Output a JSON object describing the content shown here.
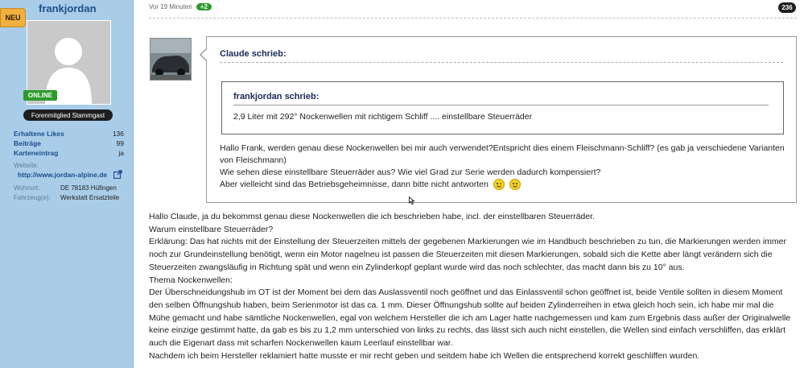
{
  "sidebar": {
    "badge": "NEU",
    "username": "frankjordan",
    "online": "ONLINE",
    "rank": "Forenmitglied Stammgast",
    "stats": [
      {
        "label": "Erhaltene Likes",
        "value": "136"
      },
      {
        "label": "Beiträge",
        "value": "99"
      },
      {
        "label": "Karteneintrag",
        "value": "ja"
      }
    ],
    "website_label": "Website:",
    "website_url": "http://www.jordan-alpine.de",
    "wohnort_label": "Wohnort:",
    "wohnort_value": "DE 78183 Hüfingen",
    "fahrzeug_label": "Fahrzeug(e):",
    "fahrzeug_value": "Werkstatt Ersatzteile"
  },
  "post": {
    "time": "Vor 19 Minuten",
    "plus": "+2",
    "number": "236"
  },
  "quote": {
    "author": "Claude schrieb:",
    "inner_author": "frankjordan schrieb:",
    "inner_text": "2,9 Liter mit 292° Nockenwellen mit richtigem Schliff .... einstellbare Steuerräder",
    "lines": [
      "Hallo Frank, werden genau diese Nockenwellen bei mir auch verwendet?Entspricht dies einem Fleischmann-Schliff? (es gab ja verschiedene Varianten von Fleischmann)",
      "Wie sehen diese einstellbare Steuerräder aus? Wie viel Grad zur Serie werden dadurch kompensiert?",
      "Aber vielleicht sind das Betriebsgeheimnisse, dann bitte nicht antworten"
    ]
  },
  "reply": {
    "lines": [
      "Hallo Claude, ja du bekommst genau diese Nockenwellen die ich beschrieben habe, incl. der einstellbaren Steuerräder.",
      "Warum einstellbare Steuerräder?",
      "Erklärung: Das hat nichts mit der Einstellung der Steuerzeiten mittels der gegebenen Markierungen wie im Handbuch beschrieben zu tun, die Markierungen werden immer noch zur Grundeinstellung benötigt, wenn ein Motor nagelneu ist passen die Steuerzeiten mit diesen Markierungen, sobald sich die Kette aber längt verändern sich die Steuerzeiten zwangsläufig in Richtung spät und wenn ein Zylinderkopf geplant wurde wird das noch schlechter, das macht dann bis zu 10° aus.",
      "Thema Nockenwellen:",
      "Der Überschneidungshub im OT ist der Moment bei dem das Auslassventil noch geöffnet und das Einlassventil schon geöffnet ist, beide Ventile sollten in diesem Moment den selben Öffnungshub haben, beim Serienmotor ist das ca. 1 mm. Dieser Öffnungshub sollte auf beiden Zylinderreihen in etwa gleich hoch sein, ich habe mir mal die Mühe gemacht und habe sämtliche Nockenwellen, egal von welchem Hersteller die ich am Lager hatte nachgemessen und kam zum Ergebnis dass außer der Originalwelle keine einzige gestimmt hatte, da gab es bis zu 1,2 mm unterschied von links zu rechts, das lässt sich auch nicht einstellen, die Wellen sind einfach verschliffen, das erklärt auch die Eigenart dass mit scharfen Nockenwellen kaum Leerlauf einstellbar war.",
      "Nachdem ich beim Hersteller reklamiert hatte musste er mir recht geben und seitdem habe ich Wellen die entsprechend korrekt geschliffen wurden."
    ]
  }
}
